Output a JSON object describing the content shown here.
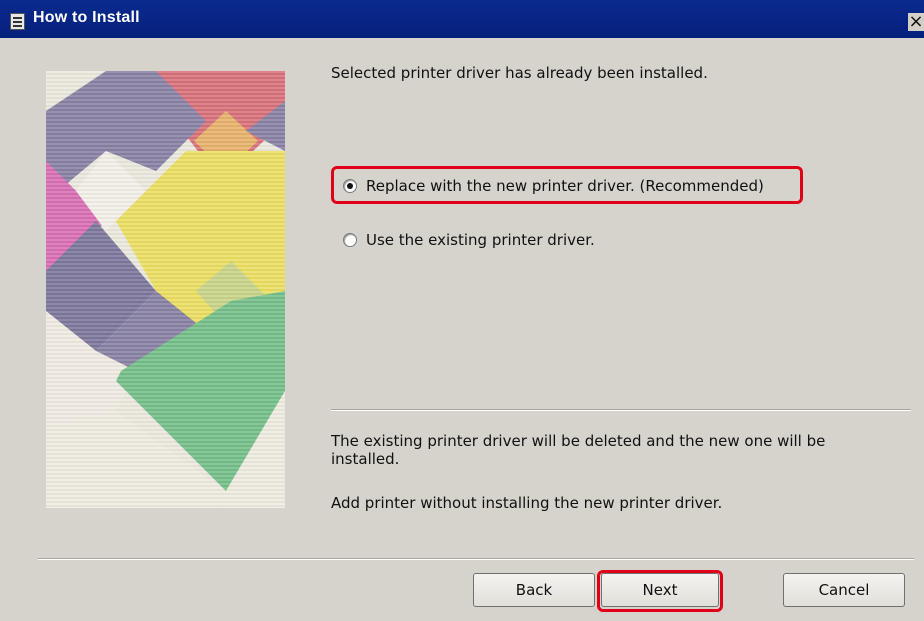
{
  "window": {
    "title": "How to Install",
    "close_label": "×"
  },
  "main": {
    "message": "Selected printer driver has already been installed.",
    "options": [
      {
        "label": "Replace with the new printer driver. (Recommended)",
        "checked": true
      },
      {
        "label": "Use the existing printer driver.",
        "checked": false
      }
    ],
    "description_1": "The existing printer driver will be deleted and the new one will be installed.",
    "description_2": "Add printer without installing the new printer driver."
  },
  "buttons": {
    "back": "Back",
    "next": "Next",
    "cancel": "Cancel"
  },
  "colors": {
    "titlebar": "#0a2a8f",
    "highlight": "#e00018",
    "background": "#d6d3cc"
  },
  "icons": {
    "app": "printer-icon",
    "close": "close-icon",
    "art": "decorative-mosaic"
  }
}
